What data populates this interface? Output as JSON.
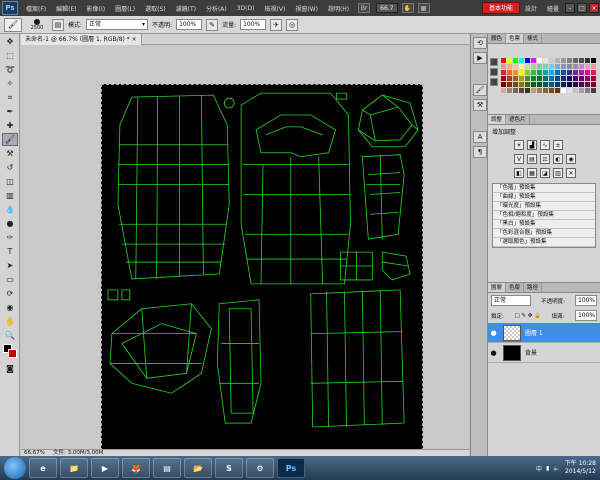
{
  "menubar": {
    "logo": "Ps",
    "items": [
      "檔案(F)",
      "編輯(E)",
      "影像(I)",
      "圖層(L)",
      "選取(S)",
      "濾鏡(T)",
      "分析(A)",
      "3D(D)",
      "檢視(V)",
      "視窗(W)",
      "說明(H)"
    ],
    "zoom": "66.7",
    "workspace_active": "基本功能",
    "workspaces": [
      "設計",
      "繪畫"
    ]
  },
  "options": {
    "brush_size": "2500",
    "mode_label": "模式:",
    "mode_value": "正常",
    "opacity_label": "不透明:",
    "opacity_value": "100%",
    "flow_label": "流量:",
    "flow_value": "100%"
  },
  "document": {
    "tab_title": "未命名-1 @ 66.7% (圖層 1, RGB/8) *",
    "zoom_status": "66.67%",
    "file_status": "文件: 3.00M/3.00M"
  },
  "panels": {
    "swatch_tabs": [
      "色票",
      "樣式"
    ],
    "adjust_tabs": [
      "調整",
      "遮色片"
    ],
    "adjust_title": "增加調整",
    "presets": [
      "「色階」預設集",
      "「曲線」預設集",
      "「曝光度」預設集",
      "「色相/飽和度」預設集",
      "「黑白」預設集",
      "「色彩混合器」預設集",
      "「選取顏色」預設集"
    ],
    "layer_tabs": [
      "圖層",
      "色版",
      "路徑"
    ],
    "blend_mode": "正常",
    "opacity_label": "不透明度:",
    "opacity_value": "100%",
    "lock_label": "鎖定:",
    "fill_label": "填滿:",
    "fill_value": "100%",
    "layers": [
      {
        "name": "圖層 1",
        "selected": true
      },
      {
        "name": "背景",
        "selected": false
      }
    ]
  },
  "swatch_colors": [
    "#ff0000",
    "#ffff00",
    "#00ff00",
    "#00ffff",
    "#0000ff",
    "#ff00ff",
    "#ffffff",
    "#e6e6e6",
    "#cccccc",
    "#b3b3b3",
    "#999999",
    "#808080",
    "#666666",
    "#4d4d4d",
    "#333333",
    "#000000",
    "#f7977a",
    "#f9ad81",
    "#fdc68a",
    "#fff79a",
    "#c4df9b",
    "#a3d39c",
    "#82ca9d",
    "#7bcdc8",
    "#6ecff6",
    "#7ea7d8",
    "#8493ca",
    "#8882be",
    "#a187be",
    "#bc8dbf",
    "#f49ac2",
    "#f6989d",
    "#ed1c24",
    "#f26522",
    "#f7941d",
    "#fff200",
    "#8dc63f",
    "#39b54a",
    "#00a651",
    "#00a99d",
    "#00aeef",
    "#0072bc",
    "#0054a6",
    "#2e3192",
    "#662d91",
    "#92278f",
    "#ec008c",
    "#ed145b",
    "#9e0b0f",
    "#a0410d",
    "#a36209",
    "#aba000",
    "#598527",
    "#1a7b30",
    "#007236",
    "#00746b",
    "#0076a3",
    "#004b80",
    "#003471",
    "#1b1464",
    "#440e62",
    "#630460",
    "#9e005d",
    "#9e0039",
    "#790000",
    "#7b2e00",
    "#7d4900",
    "#827b00",
    "#406618",
    "#005e20",
    "#005826",
    "#005952",
    "#005b7f",
    "#003663",
    "#002157",
    "#0d004c",
    "#32004b",
    "#4b0049",
    "#7b0046",
    "#7a0026",
    "#c7b299",
    "#998675",
    "#736357",
    "#534741",
    "#37302d",
    "#c69c6d",
    "#a67c52",
    "#8c6239",
    "#754c24",
    "#603913",
    "#ffffff",
    "#e0e0e0",
    "#c0c0c0",
    "#a0a0a0",
    "#808080",
    "#404040"
  ],
  "taskbar": {
    "apps": [
      "e",
      "📁",
      "▶",
      "🦊",
      "▤",
      "📂",
      "S",
      "⚙",
      "Ps"
    ],
    "lang": "中",
    "time": "下午 10:28",
    "date": "2014/5/12"
  }
}
